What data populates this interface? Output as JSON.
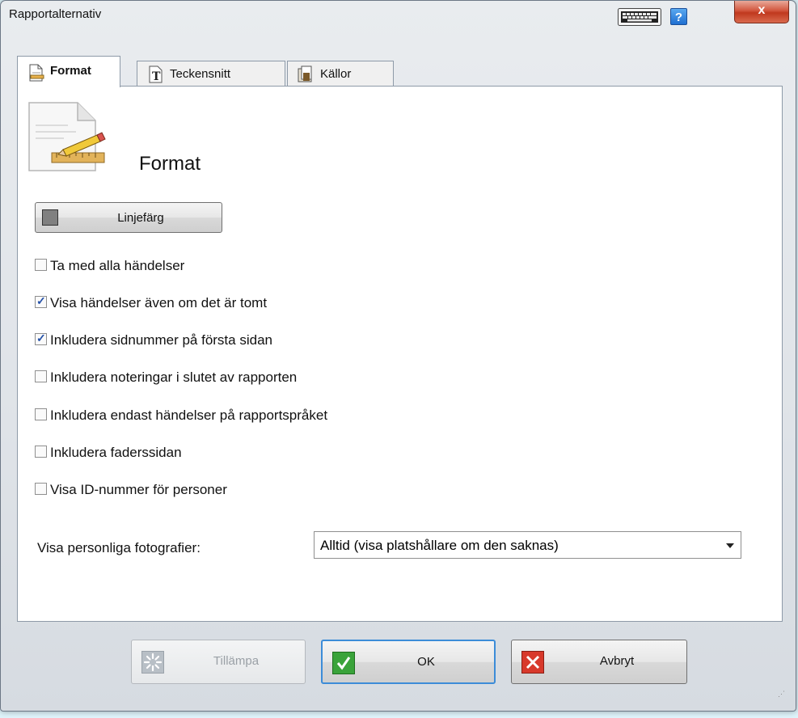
{
  "window": {
    "title": "Rapportalternativ",
    "close_label": "x",
    "help_label": "?"
  },
  "tabs": [
    {
      "label": "Format",
      "active": true
    },
    {
      "label": "Teckensnitt",
      "active": false
    },
    {
      "label": "Källor",
      "active": false
    }
  ],
  "panel": {
    "title": "Format"
  },
  "line_color_button": {
    "label": "Linjefärg",
    "swatch_color": "#808080"
  },
  "checkboxes": [
    {
      "label": "Ta med alla händelser",
      "checked": false
    },
    {
      "label": "Visa händelser även om det är tomt",
      "checked": true
    },
    {
      "label": "Inkludera sidnummer på första sidan",
      "checked": true
    },
    {
      "label": "Inkludera noteringar i slutet av rapporten",
      "checked": false
    },
    {
      "label": "Inkludera endast händelser på rapportspråket",
      "checked": false
    },
    {
      "label": "Inkludera faderssidan",
      "checked": false
    },
    {
      "label": "Visa ID-nummer för personer",
      "checked": false
    }
  ],
  "photos": {
    "label": "Visa personliga fotografier:",
    "selected": "Alltid (visa platshållare om den saknas)"
  },
  "footer": {
    "apply_label": "Tillämpa",
    "ok_label": "OK",
    "cancel_label": "Avbryt"
  },
  "colors": {
    "ok_green": "#3aa33a",
    "cancel_red": "#d8392b",
    "accent_blue": "#3c8cd8"
  }
}
